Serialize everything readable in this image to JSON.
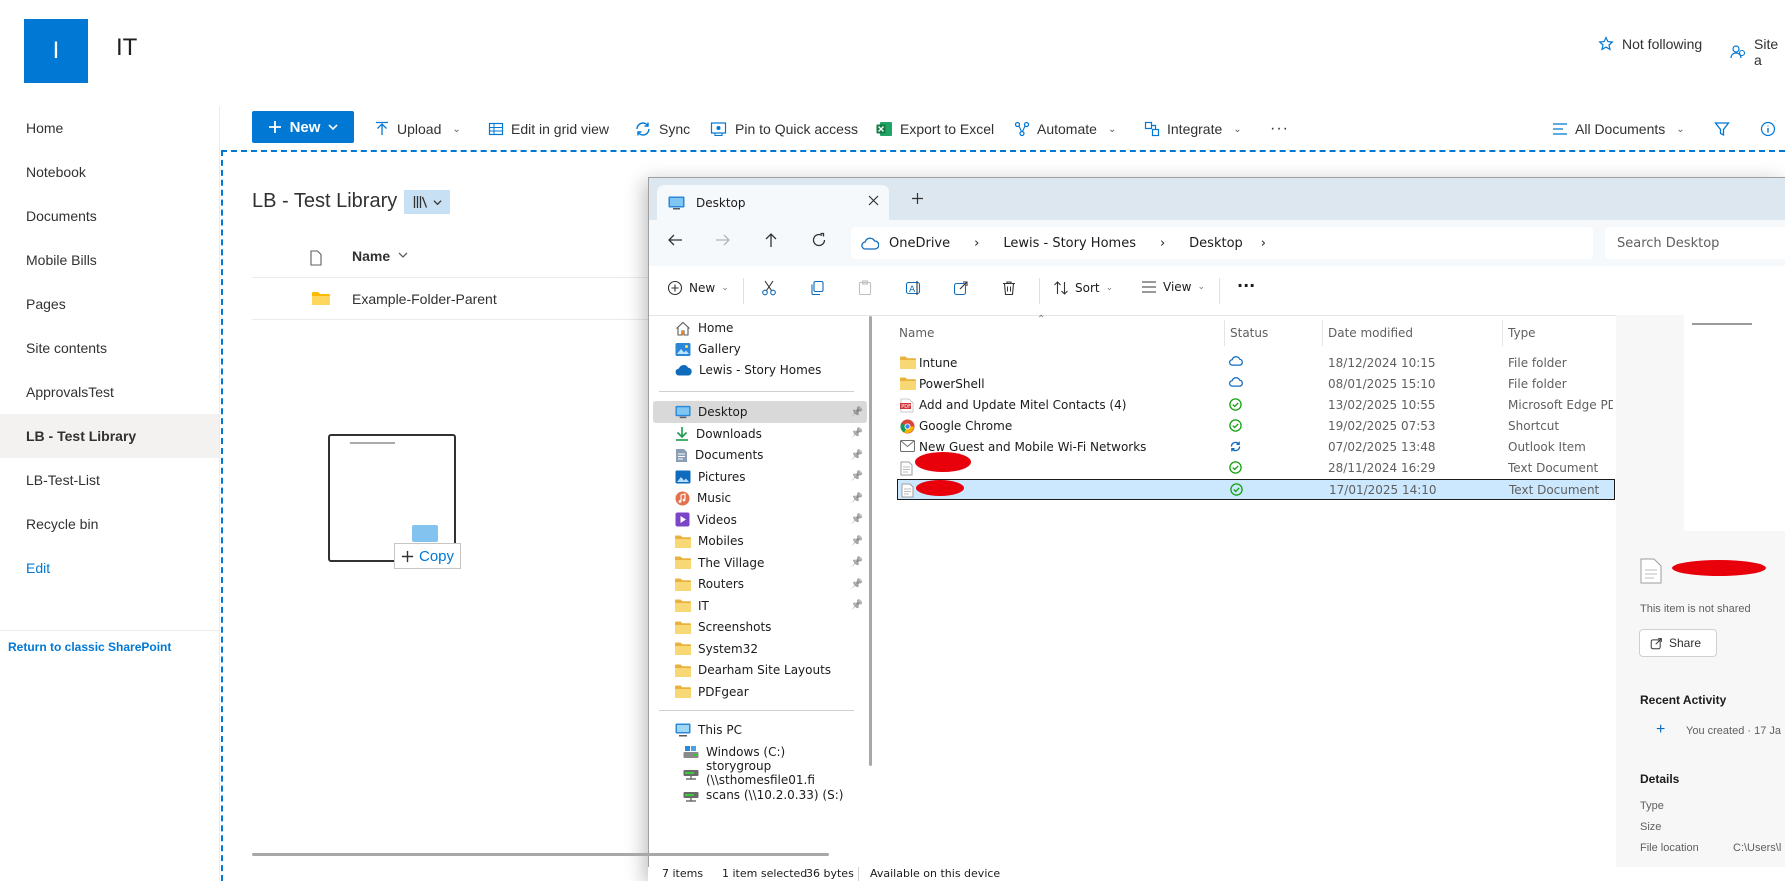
{
  "header": {
    "logo_letter": "I",
    "site_title": "IT",
    "follow_label": "Not following",
    "site_access_label": "Site a"
  },
  "left_nav": {
    "items": [
      "Home",
      "Notebook",
      "Documents",
      "Mobile Bills",
      "Pages",
      "Site contents",
      "ApprovalsTest",
      "LB - Test Library",
      "LB-Test-List",
      "Recycle bin"
    ],
    "selected": "LB - Test Library",
    "edit_label": "Edit",
    "classic_link": "Return to classic SharePoint"
  },
  "command_bar": {
    "new": "New",
    "upload": "Upload",
    "edit_grid": "Edit in grid view",
    "sync": "Sync",
    "pin": "Pin to Quick access",
    "export": "Export to Excel",
    "automate": "Automate",
    "integrate": "Integrate",
    "more": "···",
    "view_name": "All Documents"
  },
  "library": {
    "title": "LB - Test Library",
    "name_column": "Name",
    "rows": [
      {
        "name": "Example-Folder-Parent",
        "type": "folder"
      }
    ]
  },
  "drag": {
    "copy_label": "Copy"
  },
  "explorer": {
    "tab_title": "Desktop",
    "breadcrumb": [
      "OneDrive",
      "Lewis - Story Homes",
      "Desktop"
    ],
    "search_placeholder": "Search Desktop",
    "toolbar": {
      "new": "New",
      "sort": "Sort",
      "view": "View"
    },
    "nav_top": [
      "Home",
      "Gallery",
      "Lewis - Story Homes"
    ],
    "nav_quick": [
      {
        "label": "Desktop",
        "icon": "desktop",
        "pinned": true,
        "selected": true
      },
      {
        "label": "Downloads",
        "icon": "download",
        "pinned": true
      },
      {
        "label": "Documents",
        "icon": "documents",
        "pinned": true
      },
      {
        "label": "Pictures",
        "icon": "pictures",
        "pinned": true
      },
      {
        "label": "Music",
        "icon": "music",
        "pinned": true
      },
      {
        "label": "Videos",
        "icon": "videos",
        "pinned": true
      },
      {
        "label": "Mobiles",
        "icon": "folder",
        "pinned": true
      },
      {
        "label": "The Village",
        "icon": "folder",
        "pinned": true
      },
      {
        "label": "Routers",
        "icon": "folder",
        "pinned": true
      },
      {
        "label": "IT",
        "icon": "folder",
        "pinned": true
      },
      {
        "label": "Screenshots",
        "icon": "folder",
        "pinned": false
      },
      {
        "label": "System32",
        "icon": "folder",
        "pinned": false
      },
      {
        "label": "Dearham Site Layouts",
        "icon": "folder",
        "pinned": false
      },
      {
        "label": "PDFgear",
        "icon": "folder",
        "pinned": false
      }
    ],
    "nav_pc": [
      {
        "label": "This PC",
        "icon": "pc"
      },
      {
        "label": "Windows (C:)",
        "icon": "drive"
      },
      {
        "label": "storygroup (\\\\sthomesfile01.fi",
        "icon": "netdrive"
      },
      {
        "label": "scans (\\\\10.2.0.33) (S:)",
        "icon": "netdrive"
      }
    ],
    "columns": [
      "Name",
      "Status",
      "Date modified",
      "Type"
    ],
    "files": [
      {
        "name": "Intune",
        "status": "cloud",
        "date": "18/12/2024 10:15",
        "type": "File folder",
        "icon": "folder"
      },
      {
        "name": "PowerShell",
        "status": "cloud",
        "date": "08/01/2025 15:10",
        "type": "File folder",
        "icon": "folder"
      },
      {
        "name": "Add and Update Mitel Contacts (4)",
        "status": "ok",
        "date": "13/02/2025 10:55",
        "type": "Microsoft Edge PDF",
        "icon": "pdf"
      },
      {
        "name": "Google Chrome",
        "status": "ok",
        "date": "19/02/2025 07:53",
        "type": "Shortcut",
        "icon": "chrome"
      },
      {
        "name": "New Guest and Mobile Wi-Fi Networks",
        "status": "sync",
        "date": "07/02/2025 13:48",
        "type": "Outlook Item",
        "icon": "mail"
      },
      {
        "name": "",
        "status": "ok",
        "date": "28/11/2024 16:29",
        "type": "Text Document",
        "icon": "txt",
        "redacted": true
      },
      {
        "name": "",
        "status": "ok",
        "date": "17/01/2025 14:10",
        "type": "Text Document",
        "icon": "txt",
        "redacted": true,
        "selected": true
      }
    ],
    "details": {
      "not_shared": "This item is not shared",
      "share": "Share",
      "recent_activity": "Recent Activity",
      "activity": "You created · 17 Ja",
      "details_title": "Details",
      "fields": [
        "Type",
        "Size",
        "File location"
      ],
      "location_value": "C:\\Users\\l"
    },
    "status_bar": {
      "items": "7 items",
      "selected": "1 item selected",
      "size": "36 bytes",
      "availability": "Available on this device"
    }
  }
}
